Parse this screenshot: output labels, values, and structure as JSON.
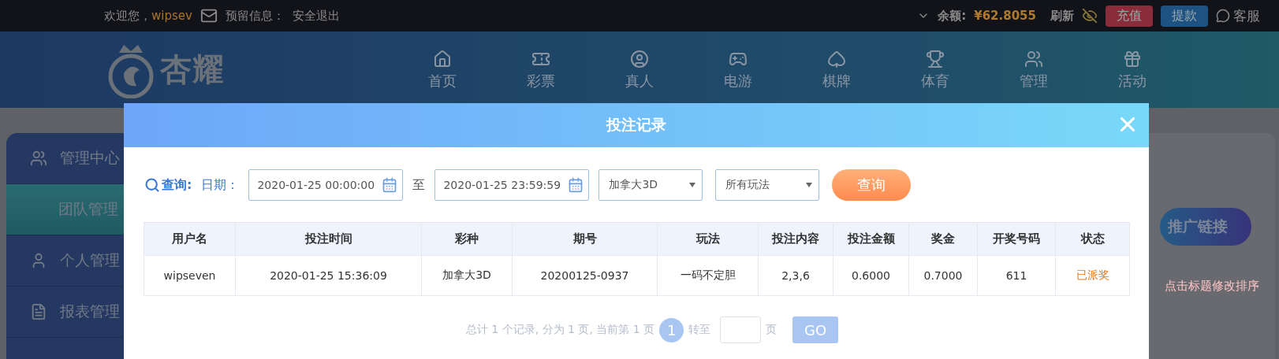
{
  "top_bar": {
    "welcome": "欢迎您，",
    "username": "wipsev",
    "reserved_info": "预留信息：",
    "logout": "安全退出",
    "balance_label": "余额:",
    "balance": "¥62.8055",
    "refresh": "刷新",
    "buttons": [
      {
        "label": "充值",
        "kind": "deposit"
      },
      {
        "label": "提款",
        "kind": "withdraw"
      }
    ],
    "service": "客服"
  },
  "header": {
    "logo_text": "杏耀",
    "nav": [
      {
        "label": "首页",
        "kind": "home"
      },
      {
        "label": "彩票",
        "kind": "lottery"
      },
      {
        "label": "真人",
        "kind": "live"
      },
      {
        "label": "电游",
        "kind": "slots"
      },
      {
        "label": "棋牌",
        "kind": "cards"
      },
      {
        "label": "体育",
        "kind": "sports"
      },
      {
        "label": "管理",
        "kind": "manage"
      },
      {
        "label": "活动",
        "kind": "events"
      }
    ]
  },
  "sidebar": {
    "items": [
      {
        "label": "管理中心",
        "kind": "group",
        "selected": false
      },
      {
        "label": "团队管理",
        "kind": "sub",
        "selected": true
      },
      {
        "label": "个人管理",
        "kind": "group",
        "selected": false
      },
      {
        "label": "报表管理",
        "kind": "group",
        "selected": false
      }
    ]
  },
  "content": {
    "promo_button": "推广链接",
    "hint": "点击标题修改排序"
  },
  "modal": {
    "title": "投注记录",
    "query_label": "查询:",
    "date_label": "日期：",
    "start_date": "2020-01-25 00:00:00",
    "range_word": "至",
    "end_date": "2020-01-25 23:59:59",
    "lottery": "加拿大3D",
    "play": "所有玩法",
    "query_button": "查询",
    "table": {
      "columns": [
        "用户名",
        "投注时间",
        "彩种",
        "期号",
        "玩法",
        "投注内容",
        "投注金额",
        "奖金",
        "开奖号码",
        "状态"
      ],
      "rows": [
        [
          "wipseven",
          "2020-01-25 15:36:09",
          "加拿大3D",
          "20200125-0937",
          "一码不定胆",
          "2,3,6",
          "0.6000",
          "0.7000",
          "611",
          "已派奖"
        ]
      ]
    },
    "pagination": {
      "summary": "总计 1 个记录, 分为 1 页, 当前第 1 页",
      "pages": [
        {
          "label": "1",
          "selected": true
        }
      ],
      "goto_label": "转至",
      "page_word": "页",
      "go_button": "GO"
    }
  }
}
